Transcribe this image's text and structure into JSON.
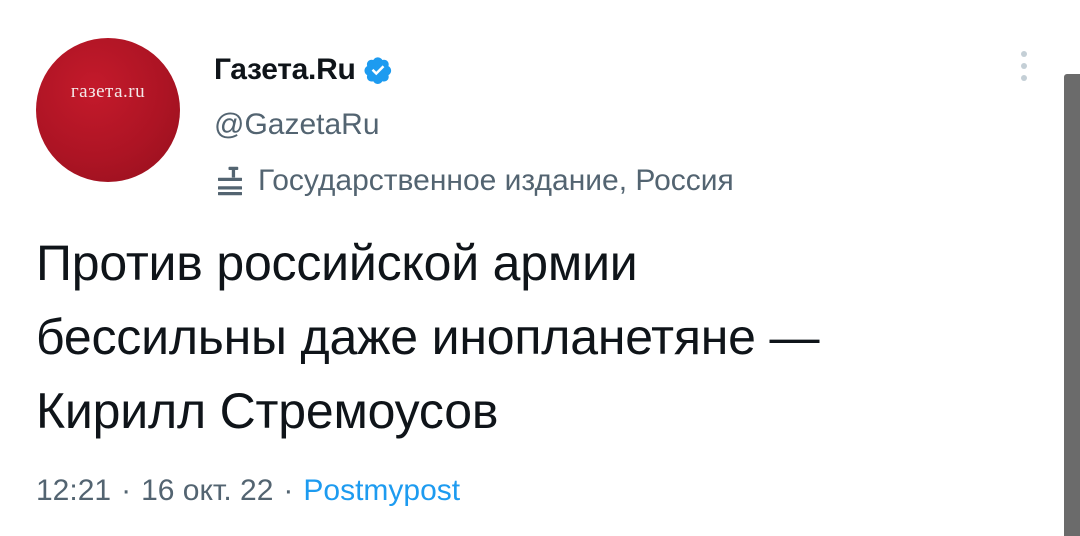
{
  "tweet": {
    "avatar_text": "газета.ru",
    "display_name": "Газета.Ru",
    "handle": "@GazetaRu",
    "label": "Государственное издание, Россия",
    "text_line1": "Против российской армии",
    "text_line2": "бессильны даже инопланетяне —",
    "text_line3": "Кирилл Стремоусов",
    "time": "12:21",
    "separator": "·",
    "date": "16 окт. 22",
    "source": "Postmypost"
  },
  "icons": {
    "verified": "verified-badge-icon",
    "label": "government-label-icon",
    "more": "more-vertical-icon"
  },
  "colors": {
    "accent": "#1d9bf0",
    "avatar_red": "#b01727",
    "text_primary": "#0f1419",
    "text_secondary": "#536471"
  }
}
